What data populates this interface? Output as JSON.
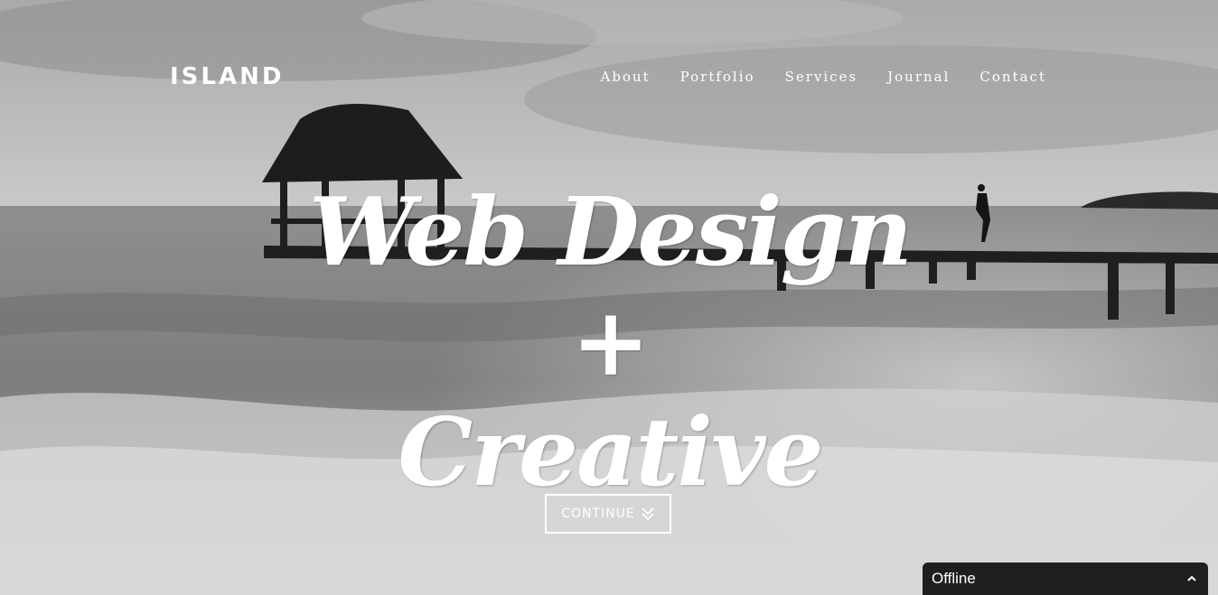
{
  "brand": {
    "name": "ISLAND"
  },
  "nav": {
    "items": [
      {
        "label": "About"
      },
      {
        "label": "Portfolio"
      },
      {
        "label": "Services"
      },
      {
        "label": "Journal"
      },
      {
        "label": "Contact"
      }
    ]
  },
  "hero": {
    "headline_line1": "Web Design +",
    "headline_line2": "Creative",
    "continue_label": "CONTINUE",
    "continue_icon": "double-chevron-down-icon",
    "background": "grayscale-beach-pier-photo"
  },
  "status_bar": {
    "label": "Offline",
    "icon": "chevron-up-icon"
  },
  "colors": {
    "text": "#ffffff",
    "status_bar_bg": "#1f1f1f"
  }
}
